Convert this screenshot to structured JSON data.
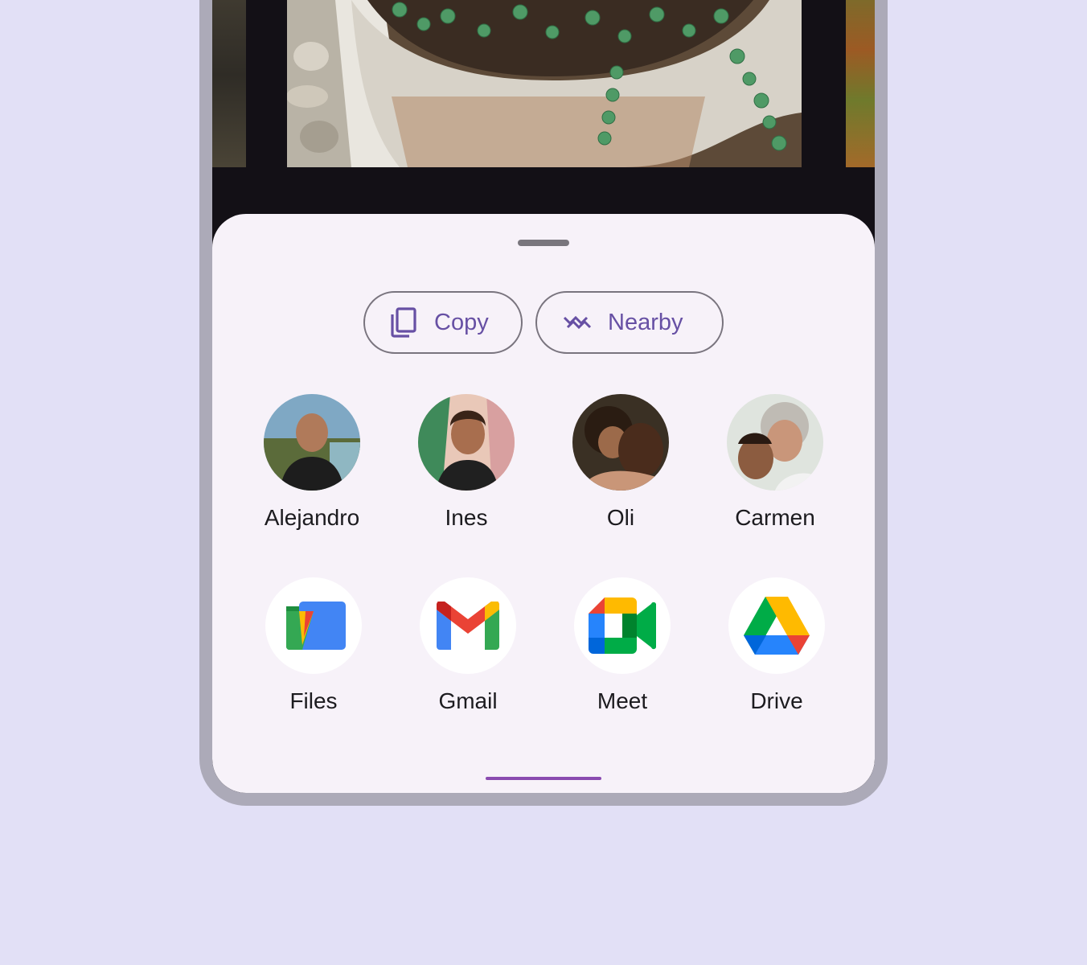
{
  "chips": {
    "copy": {
      "label": "Copy",
      "icon": "copy-icon"
    },
    "nearby": {
      "label": "Nearby",
      "icon": "nearby-share-icon"
    }
  },
  "people": [
    {
      "name": "Alejandro"
    },
    {
      "name": "Ines"
    },
    {
      "name": "Oli"
    },
    {
      "name": "Carmen"
    }
  ],
  "apps": [
    {
      "name": "Files",
      "icon": "files-app-icon"
    },
    {
      "name": "Gmail",
      "icon": "gmail-app-icon"
    },
    {
      "name": "Meet",
      "icon": "meet-app-icon"
    },
    {
      "name": "Drive",
      "icon": "drive-app-icon"
    }
  ],
  "colors": {
    "accent": "#6750a4",
    "background": "#e2e0f6",
    "sheet": "#f7f2f9",
    "nav_bar": "#8a4bb0"
  }
}
